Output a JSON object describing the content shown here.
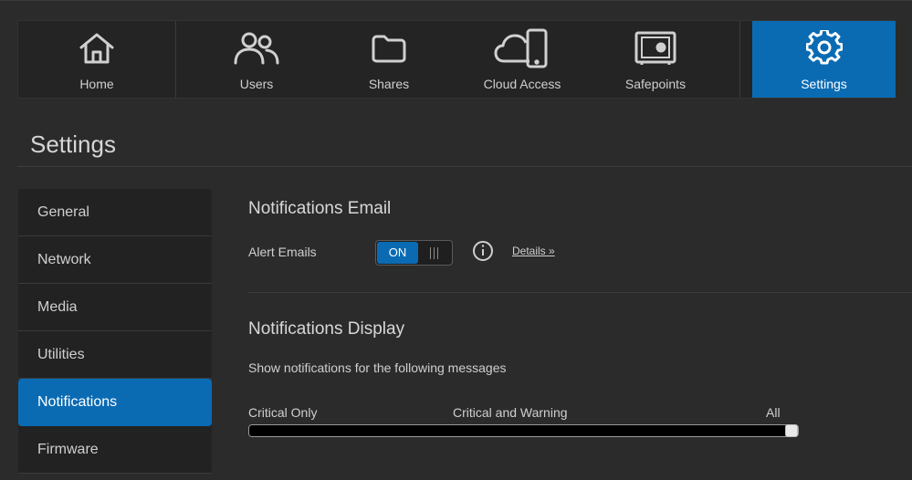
{
  "nav": {
    "items": [
      {
        "label": "Home",
        "icon": "home-icon"
      },
      {
        "label": "Users",
        "icon": "users-icon"
      },
      {
        "label": "Shares",
        "icon": "folder-icon"
      },
      {
        "label": "Cloud Access",
        "icon": "cloud-phone-icon"
      },
      {
        "label": "Safepoints",
        "icon": "safe-icon"
      },
      {
        "label": "Settings",
        "icon": "gear-icon"
      }
    ],
    "active_index": 5
  },
  "page": {
    "title": "Settings"
  },
  "sidebar": {
    "items": [
      {
        "label": "General"
      },
      {
        "label": "Network"
      },
      {
        "label": "Media"
      },
      {
        "label": "Utilities"
      },
      {
        "label": "Notifications"
      },
      {
        "label": "Firmware"
      }
    ],
    "active_index": 4
  },
  "email": {
    "title": "Notifications Email",
    "alert_label": "Alert Emails",
    "toggle_on_label": "ON",
    "toggle_state": true,
    "details_link": "Details »"
  },
  "display": {
    "title": "Notifications Display",
    "description": "Show notifications for the following messages",
    "levels": [
      "Critical Only",
      "Critical and Warning",
      "All"
    ],
    "selected_level": "All",
    "slider_fraction": 1.0
  },
  "colors": {
    "accent": "#0a6bb3",
    "background": "#2b2b2b",
    "panel": "#222222"
  }
}
